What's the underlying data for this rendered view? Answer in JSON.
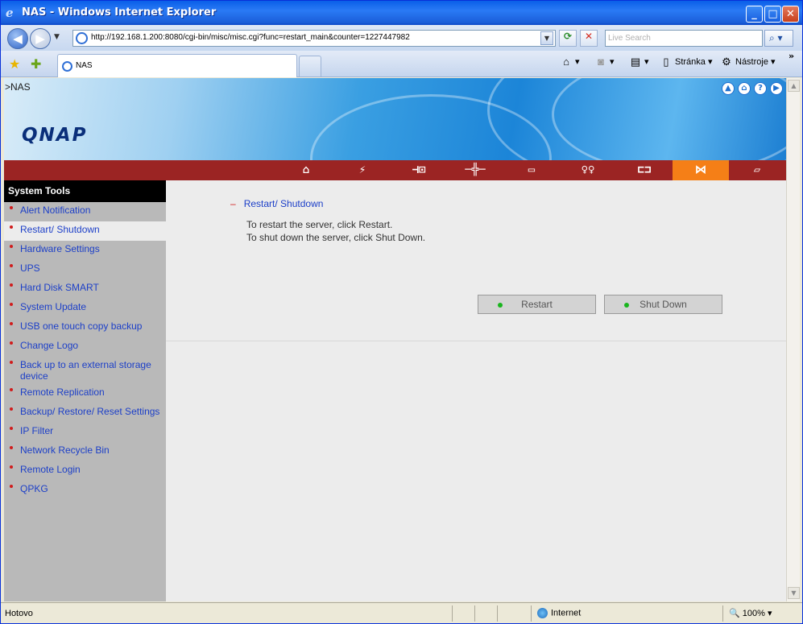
{
  "window": {
    "title": "NAS - Windows Internet Explorer",
    "min": "_",
    "max": "□",
    "close": "✕"
  },
  "addressbar": {
    "url": "http://192.168.1.200:8080/cgi-bin/misc/misc.cgi?func=restart_main&counter=1227447982",
    "search_placeholder": "Live Search"
  },
  "tabs": {
    "active_label": "NAS"
  },
  "commandbar": {
    "page_label": "Stránka",
    "tools_label": "Nástroje"
  },
  "page": {
    "breadcrumb": ">NAS",
    "logo": "QNAP"
  },
  "sidebar": {
    "title": "System Tools",
    "items": [
      {
        "label": "Alert Notification"
      },
      {
        "label": "Restart/ Shutdown"
      },
      {
        "label": "Hardware Settings"
      },
      {
        "label": "UPS"
      },
      {
        "label": "Hard Disk SMART"
      },
      {
        "label": "System Update"
      },
      {
        "label": "USB one touch copy backup"
      },
      {
        "label": "Change Logo"
      },
      {
        "label": "Back up to an external storage device"
      },
      {
        "label": "Remote Replication"
      },
      {
        "label": "Backup/ Restore/ Reset Settings"
      },
      {
        "label": "IP Filter"
      },
      {
        "label": "Network Recycle Bin"
      },
      {
        "label": "Remote Login"
      },
      {
        "label": "QPKG"
      }
    ],
    "selected_index": 1
  },
  "main": {
    "section_title": "Restart/ Shutdown",
    "line1": "To restart the server, click Restart.",
    "line2": "To shut down the server, click Shut Down.",
    "restart_label": "Restart",
    "shutdown_label": "Shut Down"
  },
  "statusbar": {
    "status": "Hotovo",
    "zone": "Internet",
    "zoom": "100%"
  },
  "colors": {
    "redbar": "#9b2423",
    "active_tab": "#f57f17",
    "link": "#1c3fc8"
  }
}
